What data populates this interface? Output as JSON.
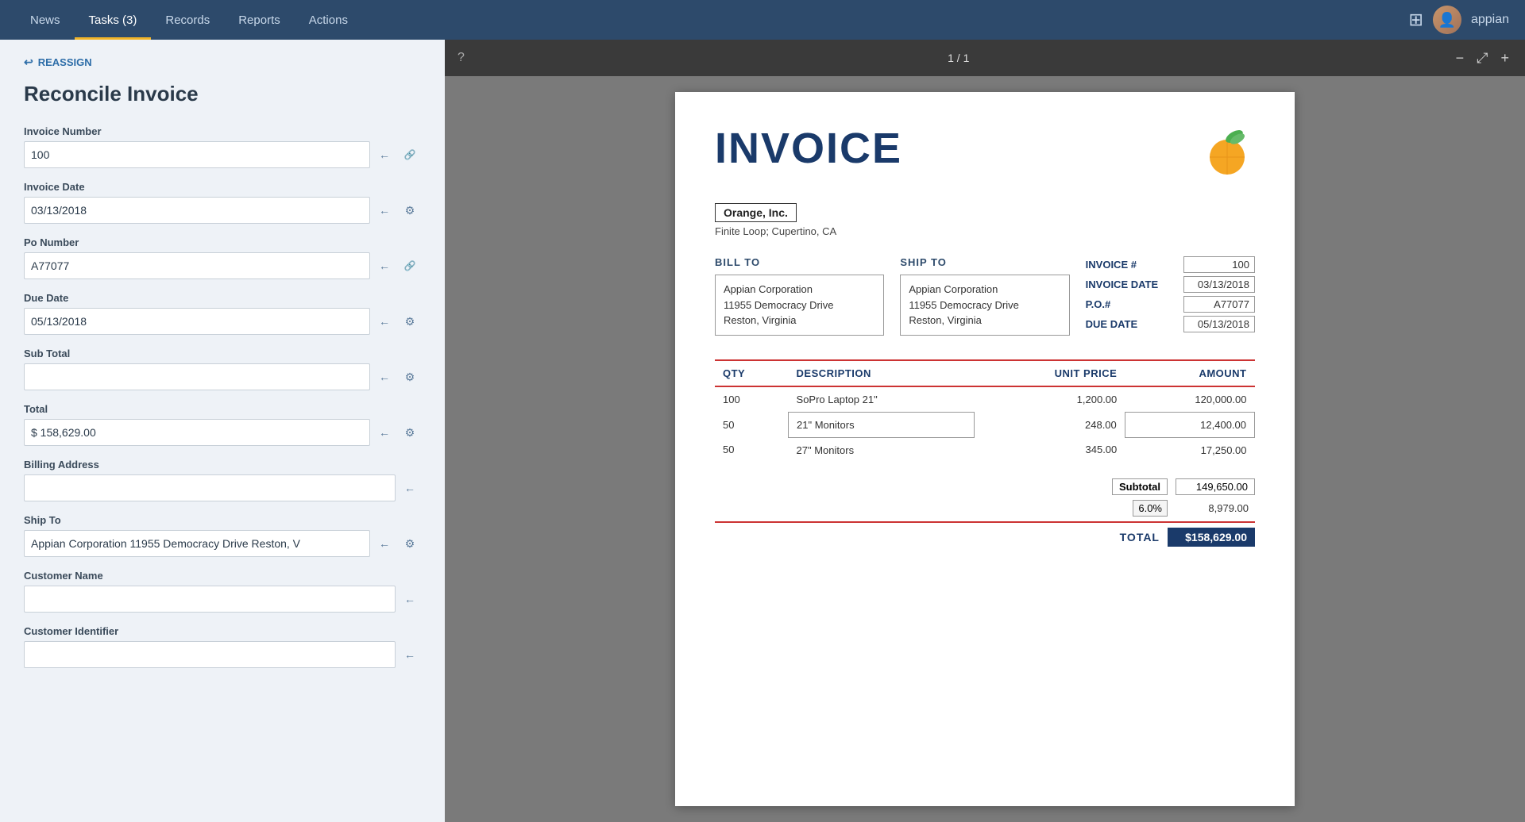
{
  "nav": {
    "items": [
      {
        "id": "news",
        "label": "News",
        "active": false
      },
      {
        "id": "tasks",
        "label": "Tasks (3)",
        "active": true
      },
      {
        "id": "records",
        "label": "Records",
        "active": false
      },
      {
        "id": "reports",
        "label": "Reports",
        "active": false
      },
      {
        "id": "actions",
        "label": "Actions",
        "active": false
      }
    ],
    "brand": "appian",
    "grid_icon": "⊞"
  },
  "page": {
    "reassign_label": "REASSIGN",
    "title": "Reconcile Invoice"
  },
  "form": {
    "fields": [
      {
        "id": "invoice-number",
        "label": "Invoice Number",
        "value": "100",
        "has_arrow": true,
        "has_link": true
      },
      {
        "id": "invoice-date",
        "label": "Invoice Date",
        "value": "03/13/2018",
        "has_arrow": true,
        "has_sync": true
      },
      {
        "id": "po-number",
        "label": "Po Number",
        "value": "A77077",
        "has_arrow": true,
        "has_link": true
      },
      {
        "id": "due-date",
        "label": "Due Date",
        "value": "05/13/2018",
        "has_arrow": true,
        "has_sync": true
      },
      {
        "id": "sub-total",
        "label": "Sub Total",
        "value": "",
        "has_arrow": true,
        "has_sync": true
      },
      {
        "id": "total",
        "label": "Total",
        "value": "$ 158,629.00",
        "has_arrow": true,
        "has_sync": true
      },
      {
        "id": "billing-address",
        "label": "Billing Address",
        "value": "",
        "has_arrow": true,
        "has_sync": false
      },
      {
        "id": "ship-to",
        "label": "Ship To",
        "value": "Appian Corporation 11955 Democracy Drive Reston, V",
        "has_arrow": true,
        "has_sync": true
      },
      {
        "id": "customer-name",
        "label": "Customer Name",
        "value": "",
        "has_arrow": true,
        "has_sync": false
      },
      {
        "id": "customer-identifier",
        "label": "Customer Identifier",
        "value": "",
        "has_arrow": true,
        "has_sync": false
      }
    ]
  },
  "pdf": {
    "toolbar": {
      "page_info": "1 / 1",
      "help_icon": "?",
      "zoom_in": "+",
      "zoom_out": "−",
      "expand": "⤢"
    },
    "invoice": {
      "title": "INVOICE",
      "company_name": "Orange, Inc.",
      "company_address": "Finite Loop; Cupertino, CA",
      "bill_to": {
        "label": "BILL TO",
        "lines": [
          "Appian Corporation",
          "11955 Democracy Drive",
          "Reston, Virginia"
        ]
      },
      "ship_to": {
        "label": "SHIP TO",
        "lines": [
          "Appian Corporation",
          "11955 Democracy Drive",
          "Reston, Virginia"
        ]
      },
      "details": {
        "invoice_num_label": "INVOICE #",
        "invoice_num_value": "100",
        "invoice_date_label": "INVOICE DATE",
        "invoice_date_value": "03/13/2018",
        "po_label": "P.O.#",
        "po_value": "A77077",
        "due_date_label": "DUE DATE",
        "due_date_value": "05/13/2018"
      },
      "table": {
        "headers": [
          "QTY",
          "DESCRIPTION",
          "UNIT PRICE",
          "AMOUNT"
        ],
        "rows": [
          {
            "qty": "100",
            "desc": "SoPro Laptop 21\"",
            "unit_price": "1,200.00",
            "amount": "120,000.00",
            "highlighted": false
          },
          {
            "qty": "50",
            "desc": "21\" Monitors",
            "unit_price": "248.00",
            "amount": "12,400.00",
            "highlighted": true
          },
          {
            "qty": "50",
            "desc": "27\" Monitors",
            "unit_price": "345.00",
            "amount": "17,250.00",
            "highlighted": false
          }
        ],
        "subtotal_label": "Subtotal",
        "subtotal_value": "149,650.00",
        "tax_rate": "6.0%",
        "tax_value": "8,979.00",
        "total_label": "TOTAL",
        "total_value": "$158,629.00"
      }
    }
  }
}
